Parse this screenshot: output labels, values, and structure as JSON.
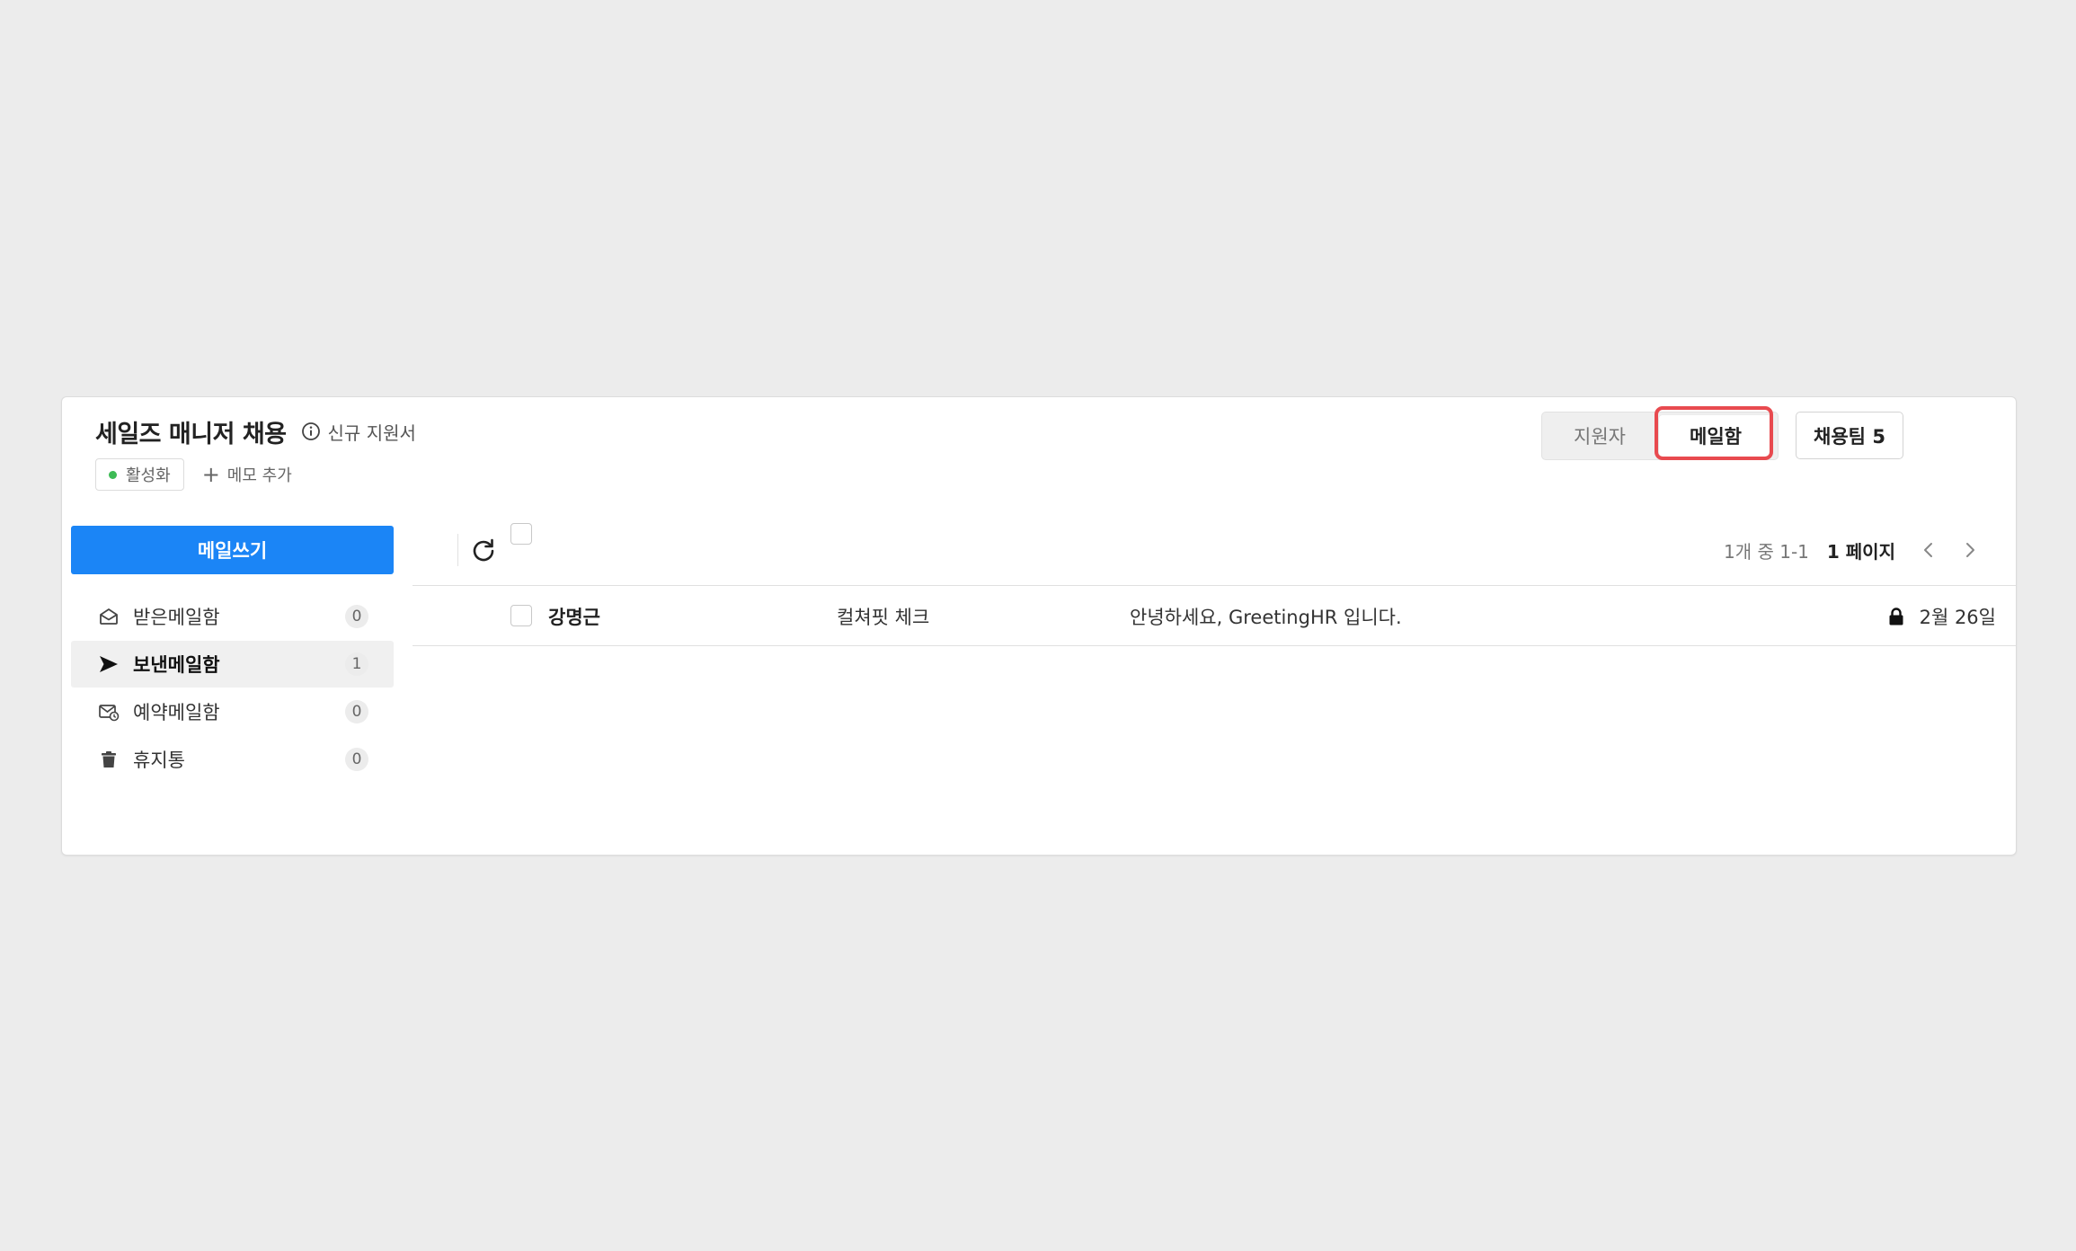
{
  "header": {
    "title": "세일즈 매니저 채용",
    "info_label": "신규 지원서",
    "status_label": "활성화",
    "add_memo_label": "메모 추가"
  },
  "view_tabs": {
    "applicants": "지원자",
    "mailbox": "메일함",
    "selected": "메일함"
  },
  "team_button_label": "채용팀 5",
  "sidebar": {
    "compose_label": "메일쓰기",
    "folders": [
      {
        "label": "받은메일함",
        "count": "0",
        "icon": "inbox-icon"
      },
      {
        "label": "보낸메일함",
        "count": "1",
        "icon": "send-icon"
      },
      {
        "label": "예약메일함",
        "count": "0",
        "icon": "scheduled-mail-icon"
      },
      {
        "label": "휴지통",
        "count": "0",
        "icon": "trash-icon"
      }
    ],
    "active_folder": "보낸메일함"
  },
  "toolbar": {
    "page_range": "1개 중 1-1",
    "page_current": "1 페이지"
  },
  "mails": [
    {
      "sender": "강명근",
      "tag": "컬쳐핏 체크",
      "subject": "안녕하세요, GreetingHR 입니다.",
      "date": "2월 26일",
      "locked": true
    }
  ],
  "colors": {
    "accent": "#1b85f6",
    "highlight": "#e84a4f",
    "status_active": "#3dbb55"
  }
}
